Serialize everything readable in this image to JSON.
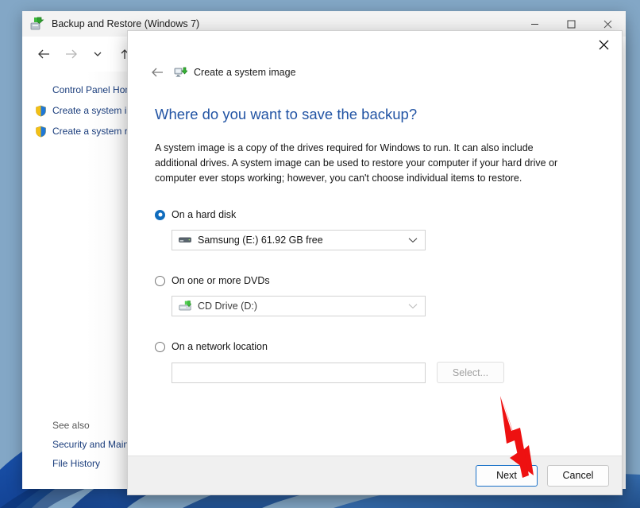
{
  "window": {
    "title": "Backup and Restore (Windows 7)",
    "icon": "backup-restore-icon",
    "caption": {
      "minimize_label": "—",
      "maximize_label": "□",
      "close_label": "✕"
    },
    "nav": {
      "back_label": "←",
      "forward_label": "→",
      "recent_label": "∨",
      "up_label": "↑"
    }
  },
  "sidebar": {
    "home_label": "Control Panel Home",
    "items": [
      {
        "label": "Create a system image",
        "icon": "shield-icon"
      },
      {
        "label": "Create a system repair",
        "icon": "shield-icon"
      }
    ],
    "see_also_heading": "See also",
    "see_also_items": [
      {
        "label": "Security and Maintena"
      },
      {
        "label": "File History"
      }
    ]
  },
  "main_pane": {
    "help_label": "?"
  },
  "wizard": {
    "close_label": "✕",
    "back_label": "←",
    "header_icon": "create-system-image-icon",
    "header_title": "Create a system image",
    "title": "Where do you want to save the backup?",
    "description": "A system image is a copy of the drives required for Windows to run. It can also include additional drives. A system image can be used to restore your computer if your hard drive or computer ever stops working; however, you can't choose individual items to restore.",
    "options": [
      {
        "id": "hard-disk",
        "label": "On a hard disk",
        "selected": true,
        "control": "combo",
        "value": "Samsung (E:)  61.92 GB free",
        "icon": "hard-drive-icon",
        "disabled": false
      },
      {
        "id": "dvd",
        "label": "On one or more DVDs",
        "selected": false,
        "control": "combo",
        "value": "CD Drive (D:)",
        "icon": "cd-drive-icon",
        "disabled": true
      },
      {
        "id": "network",
        "label": "On a network location",
        "selected": false,
        "control": "text-and-button",
        "value": "",
        "placeholder": "",
        "button_label": "Select...",
        "disabled": true
      }
    ],
    "footer": {
      "next_label": "Next",
      "cancel_label": "Cancel"
    }
  },
  "annotation": {
    "type": "red-arrow",
    "points_to": "next-button",
    "color": "#ee1111"
  },
  "colors": {
    "accent_blue": "#2254a4",
    "link_blue": "#1a3d7c",
    "radio_selected": "#0f6cbd",
    "default_button_border": "#1b72c8",
    "annotation_red": "#ee1111",
    "desktop": "#83a7c6"
  }
}
